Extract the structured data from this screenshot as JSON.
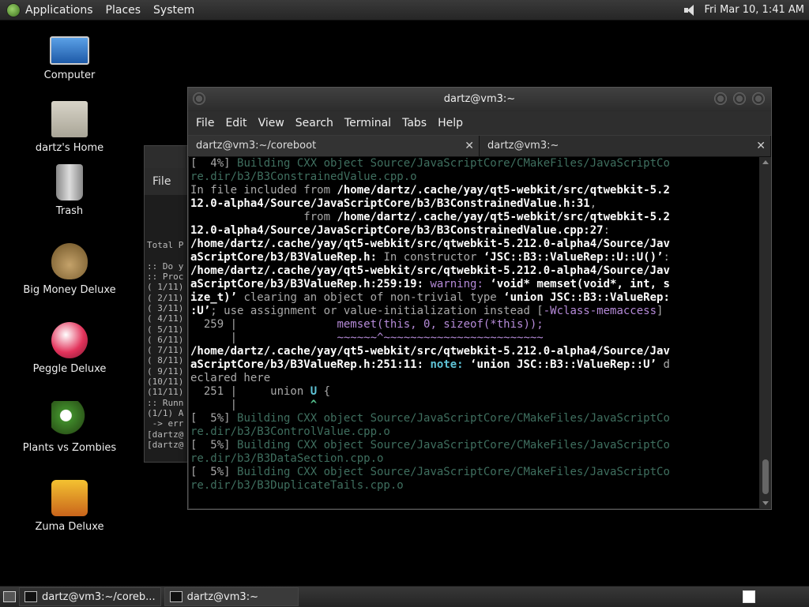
{
  "top_panel": {
    "menus": [
      "Applications",
      "Places",
      "System"
    ],
    "clock": "Fri Mar 10, 1:41 AM"
  },
  "desktop": {
    "icons": [
      {
        "label": "Computer",
        "icon": "computer-icon"
      },
      {
        "label": "dartz's Home",
        "icon": "home-folder-icon"
      },
      {
        "label": "Trash",
        "icon": "trash-icon"
      },
      {
        "label": "Big Money Deluxe",
        "icon": "money-bag-icon"
      },
      {
        "label": "Peggle Deluxe",
        "icon": "peggle-icon"
      },
      {
        "label": "Plants vs Zombies",
        "icon": "plants-vs-zombies-icon"
      },
      {
        "label": "Zuma Deluxe",
        "icon": "zuma-icon"
      }
    ]
  },
  "bg_terminal": {
    "menu": "File",
    "lines": [
      "",
      "",
      "",
      "",
      "Total P",
      "",
      ":: Do y",
      ":: Proc",
      "( 1/11)",
      "( 2/11)",
      "( 3/11)",
      "( 4/11)",
      "( 5/11)",
      "( 6/11)",
      "( 7/11)",
      "( 8/11)",
      "( 9/11)",
      "(10/11)",
      "(11/11)",
      ":: Runn",
      "(1/1) A",
      " -> err",
      "[dartz@",
      "[dartz@"
    ]
  },
  "window": {
    "title": "dartz@vm3:~",
    "menu": [
      "File",
      "Edit",
      "View",
      "Search",
      "Terminal",
      "Tabs",
      "Help"
    ],
    "tabs": [
      {
        "label": "dartz@vm3:~/coreboot",
        "active": false
      },
      {
        "label": "dartz@vm3:~",
        "active": true
      }
    ]
  },
  "terminal_lines": [
    [
      {
        "t": "[  4%] ",
        "c": "grey"
      },
      {
        "t": "Building CXX object Source/JavaScriptCore/CMakeFiles/JavaScriptCo",
        "c": "dim"
      }
    ],
    [
      {
        "t": "re.dir/b3/B3ConstrainedValue.cpp.o",
        "c": "dim"
      }
    ],
    [
      {
        "t": "In file included from ",
        "c": "grey"
      },
      {
        "t": "/home/dartz/.cache/yay/qt5-webkit/src/qtwebkit-5.2",
        "c": "bold"
      }
    ],
    [
      {
        "t": "12.0-alpha4/Source/JavaScriptCore/b3/B3ConstrainedValue.h:31",
        "c": "bold"
      },
      {
        "t": ",",
        "c": "grey"
      }
    ],
    [
      {
        "t": "                 from ",
        "c": "grey"
      },
      {
        "t": "/home/dartz/.cache/yay/qt5-webkit/src/qtwebkit-5.2",
        "c": "bold"
      }
    ],
    [
      {
        "t": "12.0-alpha4/Source/JavaScriptCore/b3/B3ConstrainedValue.cpp:27",
        "c": "bold"
      },
      {
        "t": ":",
        "c": "grey"
      }
    ],
    [
      {
        "t": "/home/dartz/.cache/yay/qt5-webkit/src/qtwebkit-5.212.0-alpha4/Source/Jav",
        "c": "bold"
      }
    ],
    [
      {
        "t": "aScriptCore/b3/B3ValueRep.h:",
        "c": "bold"
      },
      {
        "t": " In constructor ",
        "c": "grey"
      },
      {
        "t": "‘JSC::B3::ValueRep::U::U()’",
        "c": "bold"
      },
      {
        "t": ":",
        "c": "grey"
      }
    ],
    [
      {
        "t": "/home/dartz/.cache/yay/qt5-webkit/src/qtwebkit-5.212.0-alpha4/Source/Jav",
        "c": "bold"
      }
    ],
    [
      {
        "t": "aScriptCore/b3/B3ValueRep.h:259:19:",
        "c": "bold"
      },
      {
        "t": " warning: ",
        "c": "mag"
      },
      {
        "t": "‘void* memset(void*, int, s",
        "c": "bold"
      }
    ],
    [
      {
        "t": "ize_t)’",
        "c": "bold"
      },
      {
        "t": " clearing an object of non-trivial type ",
        "c": "grey"
      },
      {
        "t": "‘union JSC::B3::ValueRep:",
        "c": "bold"
      }
    ],
    [
      {
        "t": ":U’",
        "c": "bold"
      },
      {
        "t": "; use assignment or value-initialization instead [",
        "c": "grey"
      },
      {
        "t": "-Wclass-memaccess",
        "c": "mag"
      },
      {
        "t": "]",
        "c": "grey"
      }
    ],
    [
      {
        "t": "  259 |               ",
        "c": "grey"
      },
      {
        "t": "memset(this, 0, sizeof(*this));",
        "c": "mag"
      }
    ],
    [
      {
        "t": "      |               ",
        "c": "grey"
      },
      {
        "t": "~~~~~~^~~~~~~~~~~~~~~~~~~~~~~~~",
        "c": "mag"
      }
    ],
    [
      {
        "t": "/home/dartz/.cache/yay/qt5-webkit/src/qtwebkit-5.212.0-alpha4/Source/Jav",
        "c": "bold"
      }
    ],
    [
      {
        "t": "aScriptCore/b3/B3ValueRep.h:251:11:",
        "c": "bold"
      },
      {
        "t": " note: ",
        "c": "cyan"
      },
      {
        "t": "‘union JSC::B3::ValueRep::U’",
        "c": "bold"
      },
      {
        "t": " d",
        "c": "grey"
      }
    ],
    [
      {
        "t": "eclared here",
        "c": "grey"
      }
    ],
    [
      {
        "t": "  251 |     union ",
        "c": "grey"
      },
      {
        "t": "U",
        "c": "cyan"
      },
      {
        "t": " {",
        "c": "grey"
      }
    ],
    [
      {
        "t": "      |           ",
        "c": "grey"
      },
      {
        "t": "^",
        "c": "gcar"
      }
    ],
    [
      {
        "t": "[  5%] ",
        "c": "grey"
      },
      {
        "t": "Building CXX object Source/JavaScriptCore/CMakeFiles/JavaScriptCo",
        "c": "dim"
      }
    ],
    [
      {
        "t": "re.dir/b3/B3ControlValue.cpp.o",
        "c": "dim"
      }
    ],
    [
      {
        "t": "[  5%] ",
        "c": "grey"
      },
      {
        "t": "Building CXX object Source/JavaScriptCore/CMakeFiles/JavaScriptCo",
        "c": "dim"
      }
    ],
    [
      {
        "t": "re.dir/b3/B3DataSection.cpp.o",
        "c": "dim"
      }
    ],
    [
      {
        "t": "[  5%] ",
        "c": "grey"
      },
      {
        "t": "Building CXX object Source/JavaScriptCore/CMakeFiles/JavaScriptCo",
        "c": "dim"
      }
    ],
    [
      {
        "t": "re.dir/b3/B3DuplicateTails.cpp.o",
        "c": "dim"
      }
    ]
  ],
  "taskbar": {
    "items": [
      {
        "label": "dartz@vm3:~/coreb...",
        "active": false
      },
      {
        "label": "dartz@vm3:~",
        "active": true
      }
    ]
  }
}
